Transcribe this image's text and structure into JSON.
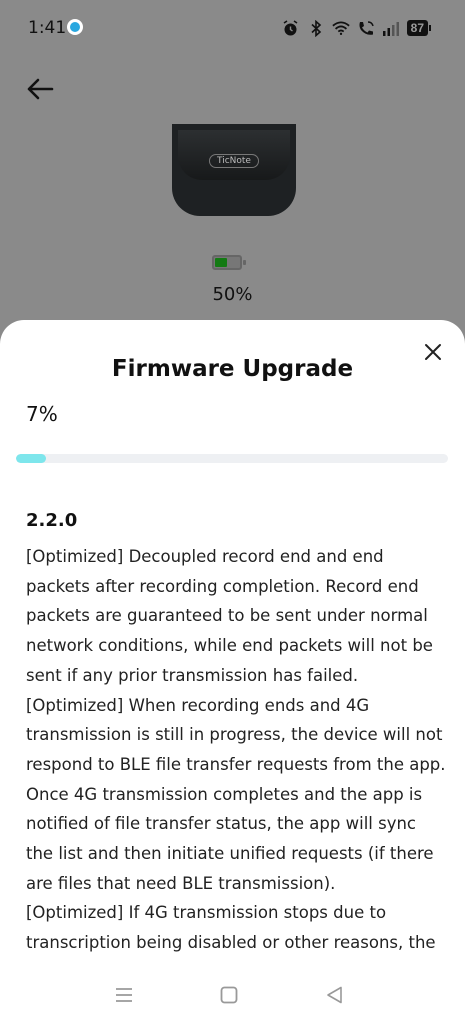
{
  "status_bar": {
    "time": "1:41",
    "battery": "87",
    "icons": [
      "alarm-icon",
      "bluetooth-icon",
      "wifi-icon",
      "wifi-calling-icon",
      "signal-icon"
    ]
  },
  "device": {
    "label": "TicNote",
    "battery_percent_text": "50%",
    "battery_level": 0.5,
    "battery_color": "#137a13"
  },
  "sheet": {
    "title": "Firmware Upgrade",
    "progress_text": "7%",
    "progress_fraction": 0.07,
    "progress_color": "#7ee6ec",
    "version": "2.2.0",
    "notes": [
      "[Optimized] Decoupled record end and end packets after recording completion. Record end packets are guaranteed to be sent under normal network conditions, while end packets will not be sent if any prior transmission has failed.",
      "[Optimized] When recording ends and 4G transmission is still in progress, the device will not respond to BLE file transfer requests from the app. Once 4G transmission completes and the app is notified of file transfer status, the app will sync the list and then initiate unified requests (if there are files that need BLE transmission).",
      "[Optimized] If 4G transmission stops due to transcription being disabled or other reasons, the"
    ]
  },
  "navbar": {
    "buttons": [
      "menu-icon",
      "home-icon",
      "back-triangle-icon"
    ]
  },
  "colors": {
    "overlay_background": "#8a8a8a",
    "sheet_background": "#ffffff"
  }
}
